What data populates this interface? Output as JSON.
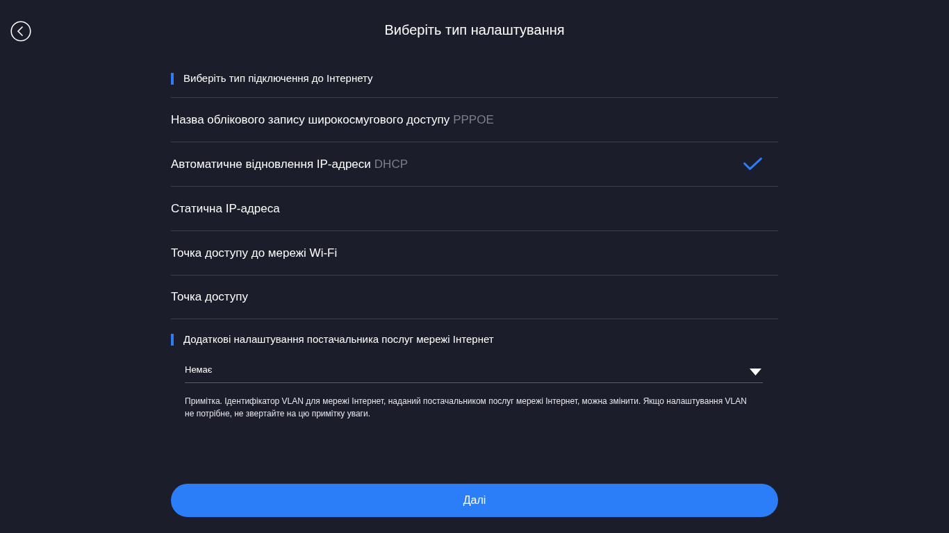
{
  "header": {
    "title": "Виберіть тип налаштування"
  },
  "connection_section": {
    "heading": "Виберіть тип підключення до Інтернету"
  },
  "options": [
    {
      "label": "Назва облікового запису широкосмугового доступу",
      "tag": "PPPOE",
      "selected": false
    },
    {
      "label": "Автоматичне відновлення IP-адреси",
      "tag": "DHCP",
      "selected": true
    },
    {
      "label": "Статична IP-адреса",
      "selected": false
    },
    {
      "label": "Точка доступу до мережі Wi-Fi",
      "selected": false
    },
    {
      "label": "Точка доступу",
      "selected": false
    }
  ],
  "isp_section": {
    "heading": "Додаткові налаштування постачальника послуг мережі Інтернет",
    "select": {
      "value": "Немає"
    },
    "note": "Примітка. Ідентифікатор VLAN для мережі Інтернет, наданий постачальником послуг мережі Інтернет, можна змінити. Якщо налаштування VLAN не потрібне, не звертайте на цю примітку уваги."
  },
  "next_button": {
    "label": "Далі"
  }
}
